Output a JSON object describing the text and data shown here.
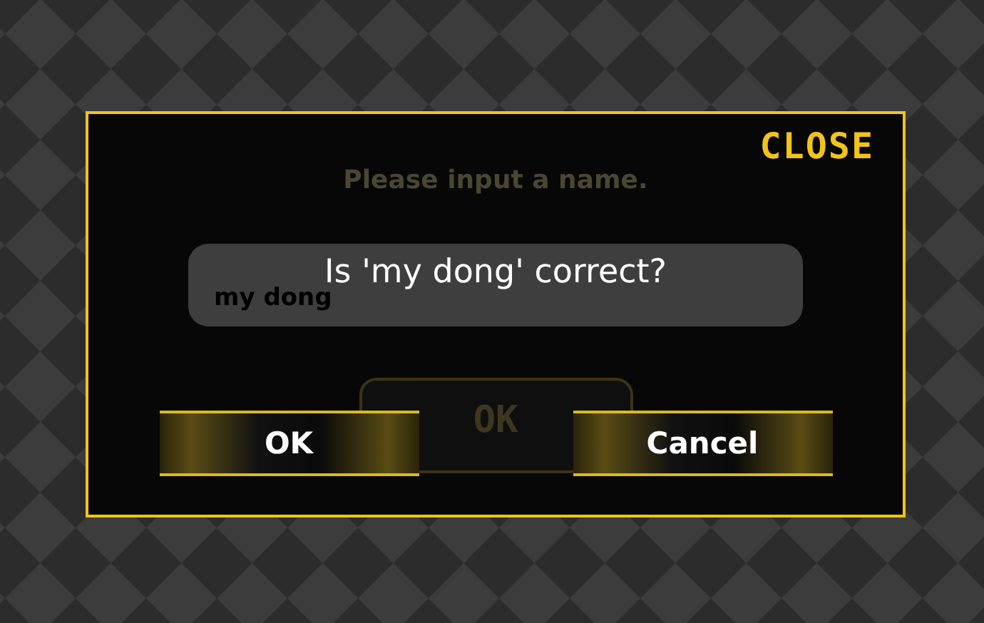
{
  "dialog": {
    "close": "CLOSE",
    "prompt": "Please input a name.",
    "name_field": {
      "value": "my dong"
    },
    "button": "OK"
  },
  "confirm": {
    "message": "Is 'my dong' correct?",
    "buttons": [
      {
        "label": "OK"
      },
      {
        "label": "Cancel"
      }
    ]
  }
}
